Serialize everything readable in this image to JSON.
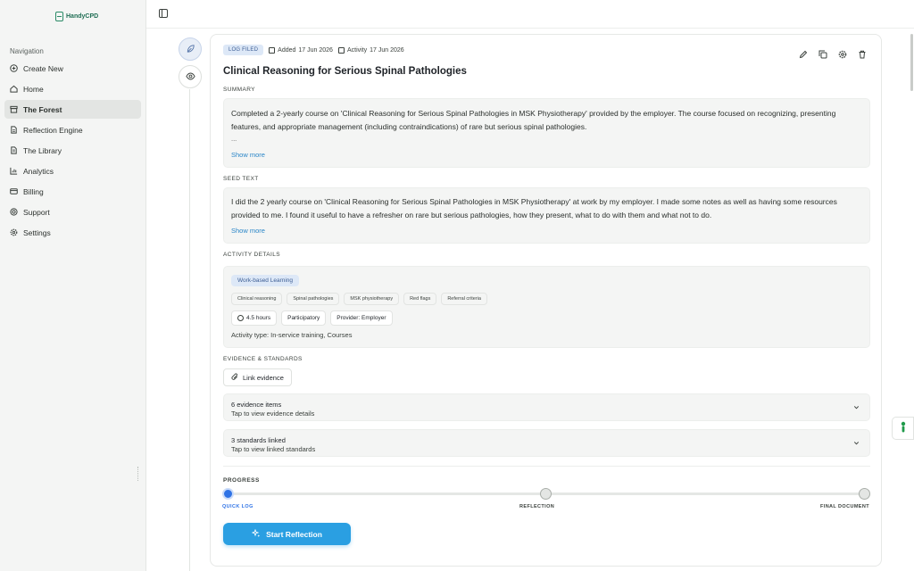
{
  "app": {
    "logo_text": "HandyCPD"
  },
  "sidebar": {
    "section_title": "Navigation",
    "items": [
      {
        "label": "Create New",
        "icon": "plus-circle-icon"
      },
      {
        "label": "Home",
        "icon": "home-icon"
      },
      {
        "label": "The Forest",
        "icon": "forest-icon",
        "active": true
      },
      {
        "label": "Reflection Engine",
        "icon": "document-icon"
      },
      {
        "label": "The Library",
        "icon": "library-icon"
      },
      {
        "label": "Analytics",
        "icon": "chart-icon"
      },
      {
        "label": "Billing",
        "icon": "credit-card-icon"
      },
      {
        "label": "Support",
        "icon": "lifebuoy-icon"
      },
      {
        "label": "Settings",
        "icon": "gear-icon"
      }
    ]
  },
  "entry": {
    "badge": "LOG FILED",
    "added_label": "Added",
    "added_date": "17 Jun 2026",
    "activity_label": "Activity",
    "activity_date": "17 Jun 2026",
    "title": "Clinical Reasoning for Serious Spinal Pathologies",
    "summary_label": "SUMMARY",
    "summary_text": "Completed a 2-yearly course on 'Clinical Reasoning for Serious Spinal Pathologies in MSK Physiotherapy' provided by the employer. The course focused on recognizing, presenting features, and appropriate management (including contraindications) of rare but serious spinal pathologies.",
    "summary_ellipsis": "...",
    "show_more": "Show more",
    "seed_label": "SEED TEXT",
    "seed_text": "I did the 2 yearly course on 'Clinical Reasoning for Serious Spinal Pathologies in MSK Physiotherapy' at work by my employer. I made some notes as well as having some resources provided to me. I found it useful to have a refresher on rare but serious pathologies, how they present, what to do with them and what not to do.",
    "activity_details_label": "ACTIVITY DETAILS",
    "category": "Work-based Learning",
    "tags": [
      "Clinical reasoning",
      "Spinal pathologies",
      "MSK physiotherapy",
      "Red flags",
      "Referral criteria"
    ],
    "hours": "4.5 hours",
    "mode": "Participatory",
    "provider": "Provider: Employer",
    "activity_type": "Activity type: In-service training, Courses",
    "evidence_label": "EVIDENCE & STANDARDS",
    "link_evidence": "Link evidence",
    "evidence_title": "6 evidence items",
    "evidence_sub": "Tap to view evidence details",
    "standards_title": "3 standards linked",
    "standards_sub": "Tap to view linked standards"
  },
  "progress": {
    "label": "PROGRESS",
    "steps": [
      {
        "label": "QUICK LOG",
        "done": true
      },
      {
        "label": "REFLECTION",
        "done": false
      },
      {
        "label": "FINAL DOCUMENT",
        "done": false
      }
    ],
    "button": "Start Reflection"
  },
  "colors": {
    "accent": "#2a9fe2",
    "progress": "#2f73e6",
    "brand": "#2a8a66"
  }
}
